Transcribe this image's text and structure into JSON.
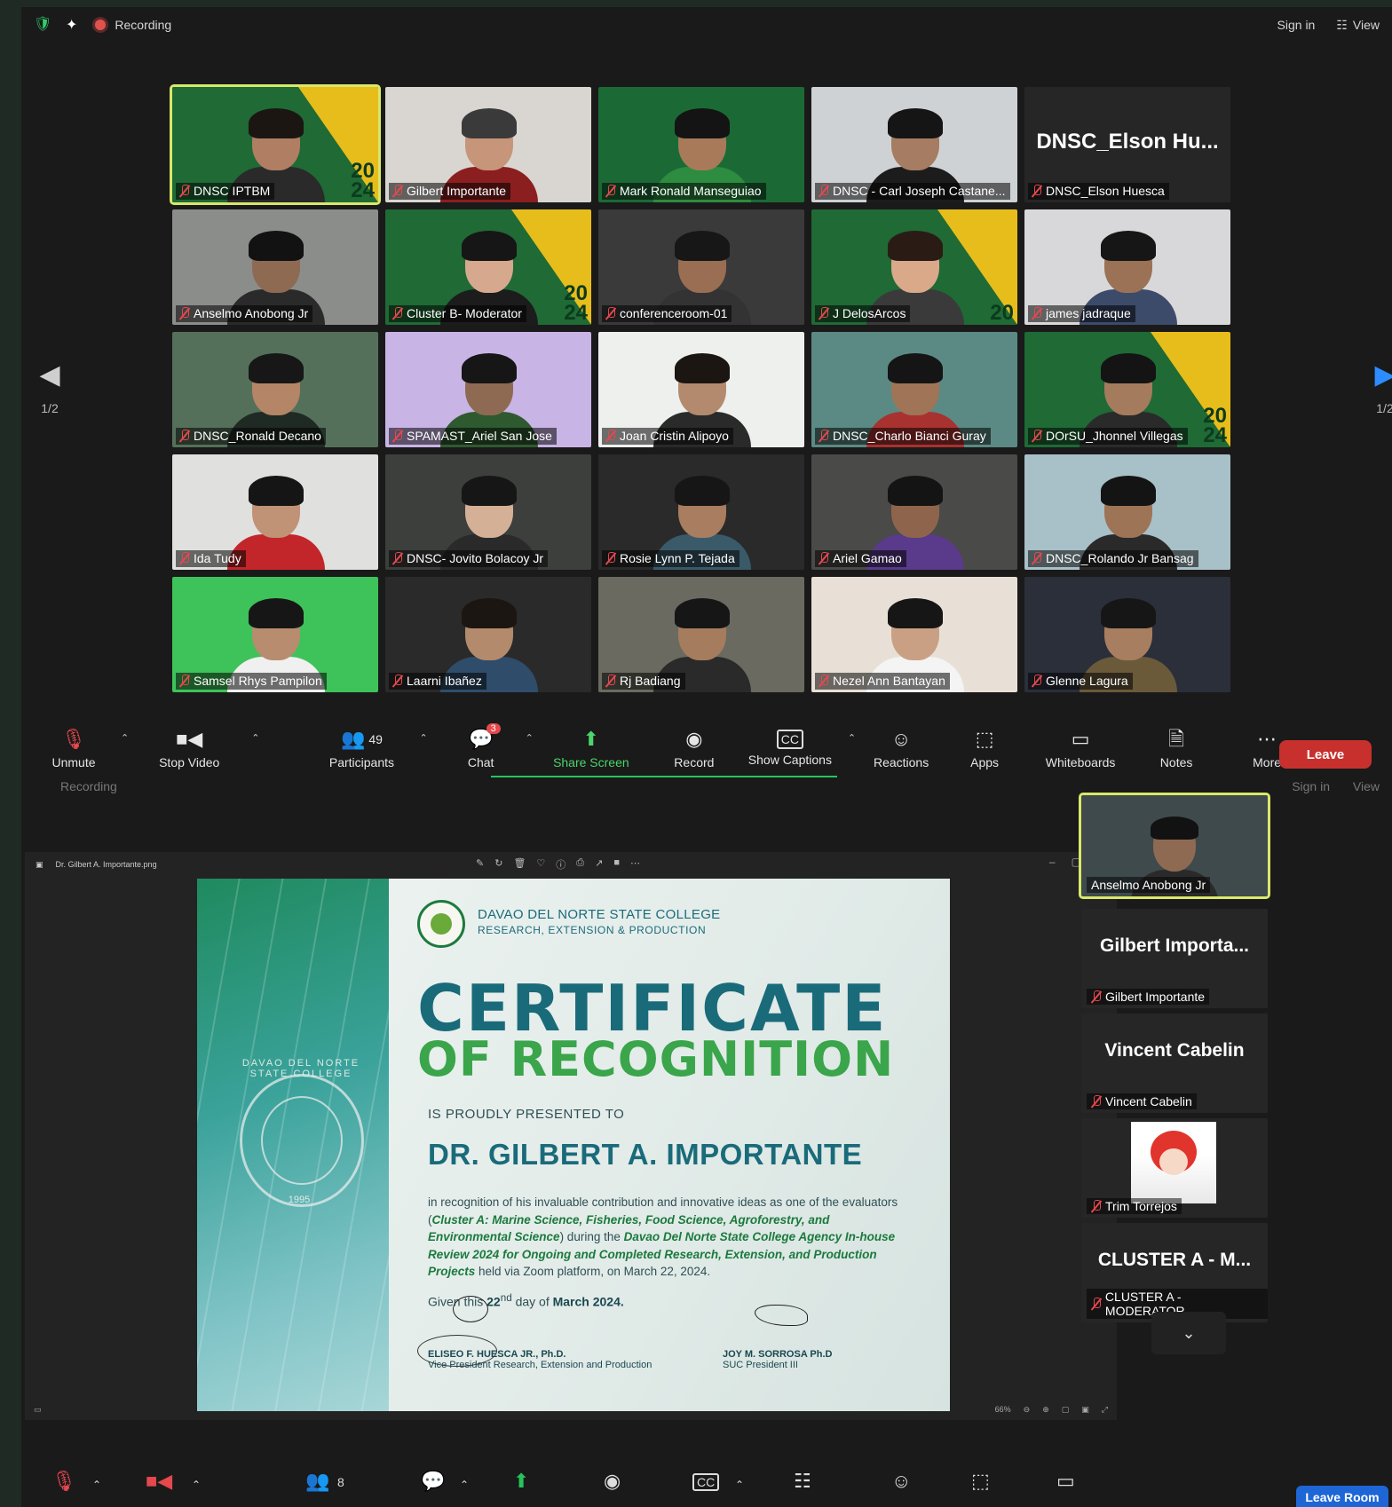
{
  "top_window": {
    "recording_label": "Recording",
    "sign_in": "Sign in",
    "view": "View",
    "page_indicator": "1/2",
    "tiles": [
      {
        "name": "DNSC IPTBM",
        "bg": "#1f6a35",
        "tri": true,
        "badge": "20\n24",
        "active": true,
        "skin": "#b07e62",
        "hair": "#1b1612",
        "shirt": "#2a2a2a"
      },
      {
        "name": "Gilbert Importante",
        "bg": "#d9d6d1",
        "tri": false,
        "skin": "#c6957a",
        "hair": "#3a3a3a",
        "shirt": "#8b1f1f"
      },
      {
        "name": "Mark Ronald Manseguiao",
        "bg": "#1b6a35",
        "tri": false,
        "skin": "#a87a5a",
        "hair": "#141414",
        "shirt": "#2d8c3f"
      },
      {
        "name": "DNSC - Carl Joseph Castane...",
        "bg": "#cfd2d4",
        "tri": false,
        "skin": "#a67c62",
        "hair": "#151515",
        "shirt": "#1c1c1c"
      },
      {
        "name": "DNSC_Elson Huesca",
        "bg": "#262626",
        "big": "DNSC_Elson Hu...",
        "noperson": true
      },
      {
        "name": "Anselmo Anobong Jr",
        "bg": "#8a8d8a",
        "tri": false,
        "skin": "#8e6a52",
        "hair": "#121212",
        "shirt": "#2a2a2a"
      },
      {
        "name": "Cluster B- Moderator",
        "bg": "#1f6a35",
        "tri": true,
        "badge": "20\n24",
        "skin": "#d6a88e",
        "hair": "#161616",
        "shirt": "#1c1c1c"
      },
      {
        "name": "conferenceroom-01",
        "bg": "#3a3a3a",
        "tri": false,
        "skin": "#9a6e52",
        "hair": "#171717",
        "shirt": "#333333"
      },
      {
        "name": "J DelosArcos",
        "bg": "#1f6a35",
        "tri": true,
        "badge": "20",
        "skin": "#d9a98a",
        "hair": "#2a1c15",
        "shirt": "#3a3a3a"
      },
      {
        "name": "james jadraque",
        "bg": "#d8d8da",
        "tri": false,
        "skin": "#9b7256",
        "hair": "#161616",
        "shirt": "#3c4b6a"
      },
      {
        "name": "DNSC_Ronald Decano",
        "bg": "#55705a",
        "tri": false,
        "skin": "#b48566",
        "hair": "#171717",
        "shirt": "#1f2a24"
      },
      {
        "name": "SPAMAST_Ariel San Jose",
        "bg": "#c9b4e6",
        "tri": false,
        "skin": "#8e6a52",
        "hair": "#161616",
        "shirt": "#2f5a2f"
      },
      {
        "name": "Joan Cristin Alipoyo",
        "bg": "#eef0ee",
        "tri": false,
        "skin": "#b48a6e",
        "hair": "#1b1612",
        "shirt": "#2a2a2a"
      },
      {
        "name": "DNSC_Charlo Bianci Guray",
        "bg": "#5b8a84",
        "tri": false,
        "skin": "#a07456",
        "hair": "#151515",
        "shirt": "#a8322f"
      },
      {
        "name": "DOrSU_Jhonnel Villegas",
        "bg": "#1f6a35",
        "tri": true,
        "badge": "20\n24",
        "skin": "#a57b5e",
        "hair": "#141414",
        "shirt": "#2a2a2a"
      },
      {
        "name": "Ida Tudy",
        "bg": "#e0e0de",
        "tri": false,
        "skin": "#c09276",
        "hair": "#151515",
        "shirt": "#c2262a"
      },
      {
        "name": "DNSC- Jovito Bolacoy Jr",
        "bg": "#3c3f3c",
        "tri": false,
        "skin": "#d4b096",
        "hair": "#161616",
        "shirt": "#2a2a2a"
      },
      {
        "name": "Rosie Lynn P. Tejada",
        "bg": "#2a2a2a",
        "tri": false,
        "skin": "#a97d60",
        "hair": "#161616",
        "shirt": "#3a5a6a"
      },
      {
        "name": "Ariel Gamao",
        "bg": "#4a4a48",
        "tri": false,
        "skin": "#8e654c",
        "hair": "#141414",
        "shirt": "#5a3a8a"
      },
      {
        "name": "DNSC_Rolando Jr Bansag",
        "bg": "#a8c0c8",
        "tri": false,
        "skin": "#9e7456",
        "hair": "#141414",
        "shirt": "#2a2a2a"
      },
      {
        "name": "Samsel Rhys Pampilon",
        "bg": "#3ec25a",
        "tri": false,
        "skin": "#b88c6e",
        "hair": "#161616",
        "shirt": "#f0f0f0"
      },
      {
        "name": "Laarni Ibañez",
        "bg": "#2a2a2a",
        "tri": false,
        "skin": "#b48a6c",
        "hair": "#1b1612",
        "shirt": "#2f4d6a"
      },
      {
        "name": "Rj Badiang",
        "bg": "#6a6a60",
        "tri": false,
        "skin": "#a67c5e",
        "hair": "#161616",
        "shirt": "#2a2a2a"
      },
      {
        "name": "Nezel Ann Bantayan",
        "bg": "#e8e0d6",
        "tri": false,
        "skin": "#caa084",
        "hair": "#161616",
        "shirt": "#f4f4f4"
      },
      {
        "name": "Glenne Lagura",
        "bg": "#2a2f3a",
        "tri": false,
        "skin": "#a87e60",
        "hair": "#161616",
        "shirt": "#6a5a3a"
      }
    ],
    "toolbar": {
      "unmute": "Unmute",
      "stop_video": "Stop Video",
      "participants": "Participants",
      "participants_count": "49",
      "chat": "Chat",
      "chat_badge": "3",
      "share_screen": "Share Screen",
      "record": "Record",
      "show_captions": "Show Captions",
      "reactions": "Reactions",
      "apps": "Apps",
      "whiteboards": "Whiteboards",
      "notes": "Notes",
      "more": "More",
      "leave": "Leave"
    }
  },
  "bottom_window": {
    "recording_label": "Recording",
    "sign_in": "Sign in",
    "view": "View",
    "viewer": {
      "file_name": "Dr. Gilbert A. Importante.png",
      "zoom_level": "66%"
    },
    "certificate": {
      "college": "DAVAO DEL NORTE STATE COLLEGE",
      "department": "RESEARCH, EXTENSION & PRODUCTION",
      "title_line1": "CERTIFICATE",
      "title_line2": "OF RECOGNITION",
      "presented": "IS PROUDLY PRESENTED TO",
      "recipient": "DR. GILBERT A. IMPORTANTE",
      "body_pre": "in recognition of his invaluable contribution and innovative ideas as one of the evaluators (",
      "body_cluster": "Cluster A: Marine Science, Fisheries, Food Science, Agroforestry, and Environmental Science",
      "body_mid": ") during the ",
      "body_event": "Davao Del Norte State College Agency In-house Review 2024 for Ongoing and Completed Research, Extension, and Production Projects",
      "body_post": " held via Zoom platform, on March 22, 2024.",
      "given_pre": "Given this ",
      "given_day": "22",
      "given_sup": "nd",
      "given_mid": " day of ",
      "given_month": "March 2024.",
      "seal_text": "DAVAO DEL NORTE STATE COLLEGE",
      "seal_year": "1995",
      "signatory1_name": "ELISEO F. HUESCA JR., Ph.D.",
      "signatory1_title": "Vice President Research, Extension and Production",
      "signatory2_name": "JOY M. SORROSA Ph.D",
      "signatory2_title": "SUC President III"
    },
    "side_tiles": [
      {
        "type": "video",
        "name": "Anselmo Anobong Jr",
        "active": true
      },
      {
        "type": "name",
        "big": "Gilbert Importa...",
        "name": "Gilbert Importante"
      },
      {
        "type": "name",
        "big": "Vincent Cabelin",
        "name": "Vincent Cabelin"
      },
      {
        "type": "avatar",
        "name": "Trim Torrejos"
      },
      {
        "type": "name",
        "big": "CLUSTER A - M...",
        "name": "CLUSTER A - MODERATOR"
      }
    ],
    "toolbar": {
      "participants_count": "8",
      "leave_room": "Leave Room"
    }
  }
}
